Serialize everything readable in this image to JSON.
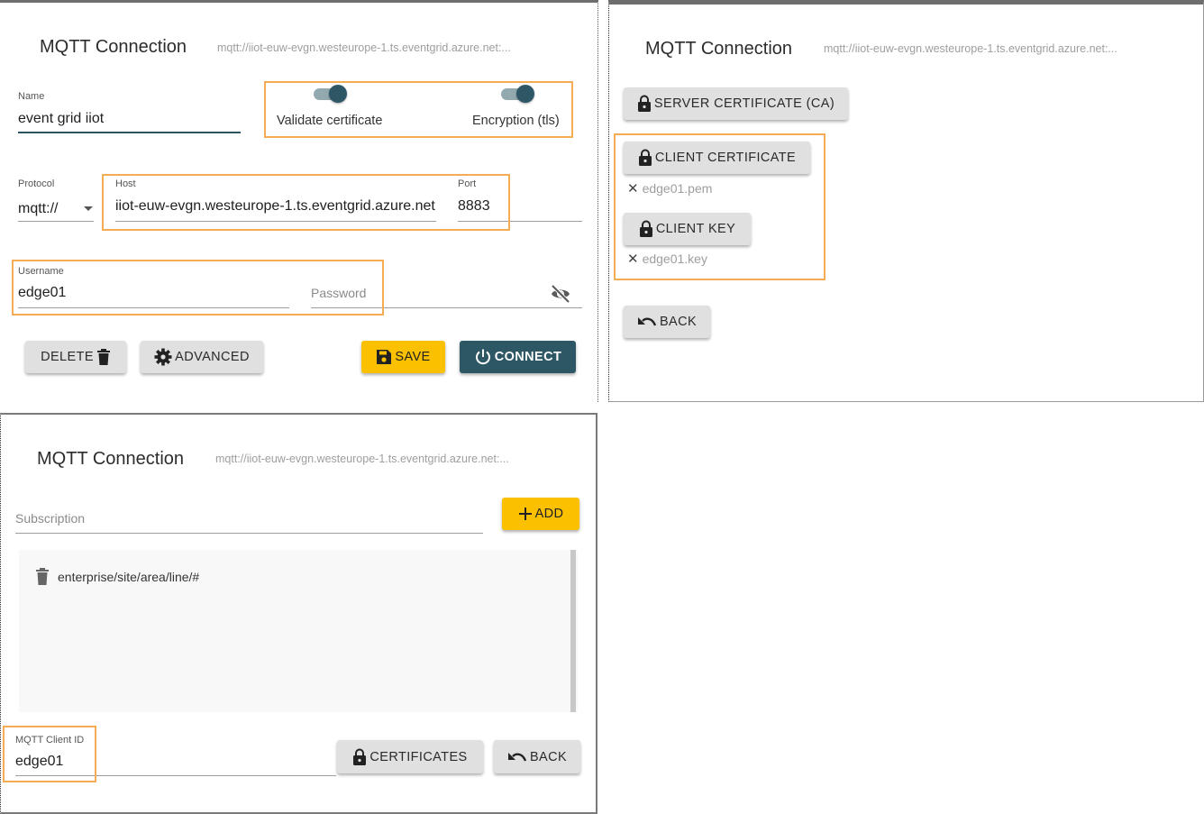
{
  "connection_panel": {
    "title": "MQTT Connection",
    "subtitle": "mqtt://iiot-euw-evgn.westeurope-1.ts.eventgrid.azure.net:...",
    "name_label": "Name",
    "name_value": "event grid iiot",
    "validate_certificate_label": "Validate certificate",
    "validate_certificate_on": true,
    "encryption_label": "Encryption (tls)",
    "encryption_on": true,
    "protocol_label": "Protocol",
    "protocol_value": "mqtt://",
    "host_label": "Host",
    "host_value": "iiot-euw-evgn.westeurope-1.ts.eventgrid.azure.net",
    "port_label": "Port",
    "port_value": "8883",
    "username_label": "Username",
    "username_value": "edge01",
    "password_placeholder": "Password",
    "buttons": {
      "delete": "DELETE",
      "advanced": "ADVANCED",
      "save": "SAVE",
      "connect": "CONNECT"
    }
  },
  "certificates_panel": {
    "title": "MQTT Connection",
    "subtitle": "mqtt://iiot-euw-evgn.westeurope-1.ts.eventgrid.azure.net:...",
    "server_certificate_button": "SERVER CERTIFICATE (CA)",
    "client_certificate_button": "CLIENT CERTIFICATE",
    "client_certificate_file": "edge01.pem",
    "client_key_button": "CLIENT KEY",
    "client_key_file": "edge01.key",
    "back_button": "BACK"
  },
  "advanced_panel": {
    "title": "MQTT Connection",
    "subtitle": "mqtt://iiot-euw-evgn.westeurope-1.ts.eventgrid.azure.net:...",
    "subscription_placeholder": "Subscription",
    "add_button": "ADD",
    "subscriptions": [
      "enterprise/site/area/line/#"
    ],
    "client_id_label": "MQTT Client ID",
    "client_id_value": "edge01",
    "certificates_button": "CERTIFICATES",
    "back_button": "BACK"
  },
  "colors": {
    "primary_teal": "#2d5765",
    "accent_yellow": "#fbc000",
    "highlight_orange": "#f5ad55"
  }
}
